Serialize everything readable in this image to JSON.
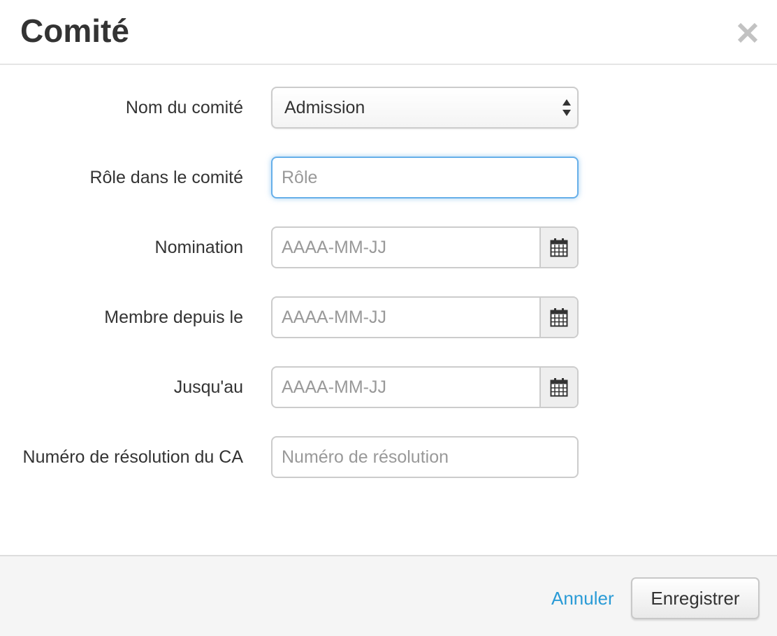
{
  "modal": {
    "title": "Comité",
    "close_icon": "close-icon"
  },
  "form": {
    "committee_name": {
      "label": "Nom du comité",
      "value": "Admission",
      "icon": "select-arrows-icon"
    },
    "role": {
      "label": "Rôle dans le comité",
      "placeholder": "Rôle",
      "value": ""
    },
    "nomination": {
      "label": "Nomination",
      "placeholder": "AAAA-MM-JJ",
      "icon": "calendar-icon"
    },
    "member_since": {
      "label": "Membre depuis le",
      "placeholder": "AAAA-MM-JJ",
      "icon": "calendar-icon"
    },
    "until": {
      "label": "Jusqu'au",
      "placeholder": "AAAA-MM-JJ",
      "icon": "calendar-icon"
    },
    "resolution": {
      "label": "Numéro de résolution du CA",
      "placeholder": "Numéro de résolution"
    }
  },
  "footer": {
    "cancel_label": "Annuler",
    "save_label": "Enregistrer"
  },
  "colors": {
    "link": "#2a9bd6",
    "focus_border": "#66afe9",
    "footer_bg": "#f5f5f5"
  }
}
